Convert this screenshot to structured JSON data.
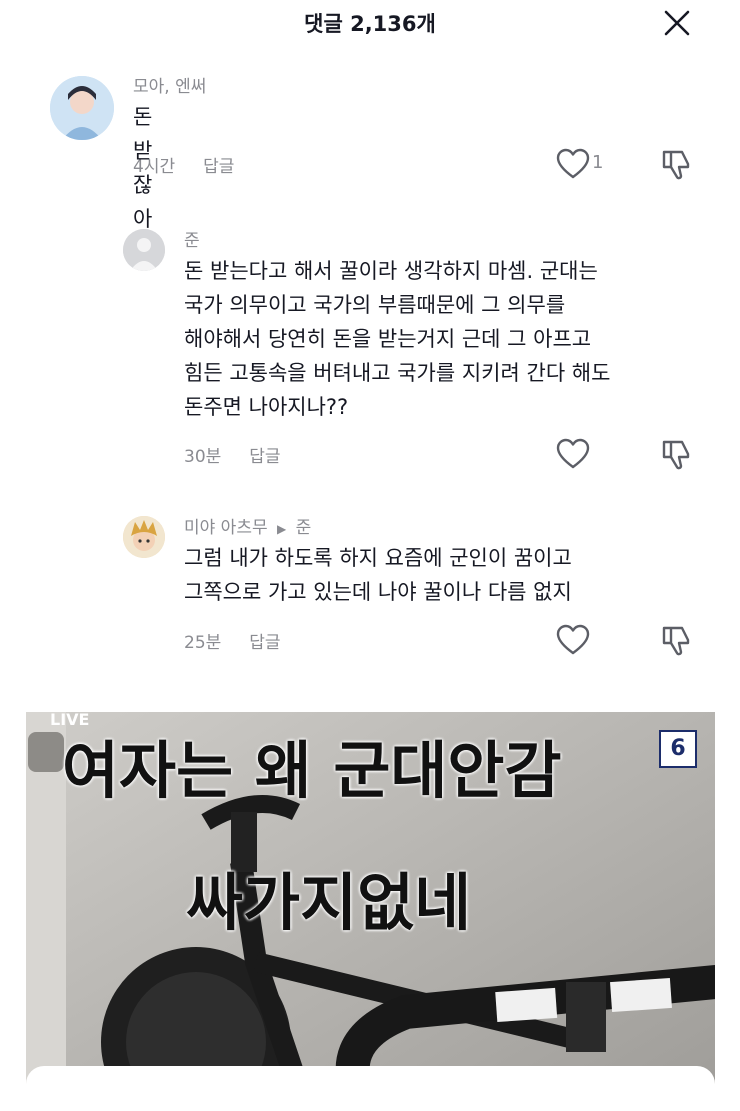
{
  "header": {
    "title": "댓글 2,136개"
  },
  "comments": [
    {
      "username": "모아, 엔써",
      "text": "돈 받잖아",
      "time": "4시간",
      "reply": "답글",
      "likes": "1"
    },
    {
      "username": "준",
      "text_lines": [
        "돈 받는다고 해서 꿀이라 생각하지 마셈. 군대는",
        "국가 의무이고 국가의 부름때문에 그 의무를",
        "해야해서 당연히 돈을 받는거지 근데 그 아프고",
        "힘든 고통속을 버텨내고 국가를 지키려 간다 해도",
        "돈주면 나아지나??"
      ],
      "time": "30분",
      "reply": "답글"
    },
    {
      "username": "미야 아츠무",
      "reply_to": "준",
      "text_lines": [
        "그럼 내가 하도록 하지 요즘에 군인이 꿈이고",
        "그쪽으로 가고 있는데 나야 꿀이나 다름 없지"
      ],
      "time": "25분",
      "reply": "답글"
    }
  ],
  "video": {
    "overlay_line1": "여자는 왜 군대안감",
    "overlay_line2": "싸가지없네",
    "live_label": "LIVE",
    "page_badge": "6"
  },
  "icons": {
    "close": "close-icon",
    "like": "heart-icon",
    "dislike": "thumbs-down-icon"
  }
}
